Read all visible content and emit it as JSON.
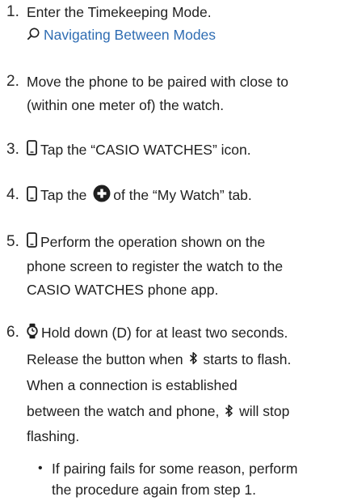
{
  "steps": [
    {
      "number": "1.",
      "line1": "Enter the Timekeeping Mode.",
      "link": "Navigating Between Modes"
    },
    {
      "number": "2.",
      "line1": "Move the phone to be paired with close to",
      "line2": "(within one meter of) the watch."
    },
    {
      "number": "3.",
      "text": "Tap the “CASIO WATCHES” icon."
    },
    {
      "number": "4.",
      "pre": "Tap the",
      "post": "of the “My Watch” tab."
    },
    {
      "number": "5.",
      "line1": "Perform the operation shown on the",
      "line2": "phone screen to register the watch to the",
      "line3": "CASIO WATCHES phone app."
    },
    {
      "number": "6.",
      "line1": "Hold down (D) for at least two seconds.",
      "line2a": "Release the button when",
      "line2b": "starts to flash.",
      "line3": "When a connection is established",
      "line4a": "between the watch and phone,",
      "line4b": "will stop",
      "line5": "flashing.",
      "bullet_line1": "If pairing fails for some reason, perform",
      "bullet_line2": "the procedure again from step 1."
    }
  ],
  "icons": {
    "search": "search-icon",
    "phone": "phone-icon",
    "plus": "plus-circle-icon",
    "watch": "watch-icon",
    "bluetooth": "bluetooth-icon"
  },
  "colors": {
    "text": "#1f1f1f",
    "link": "#2f6db3"
  }
}
